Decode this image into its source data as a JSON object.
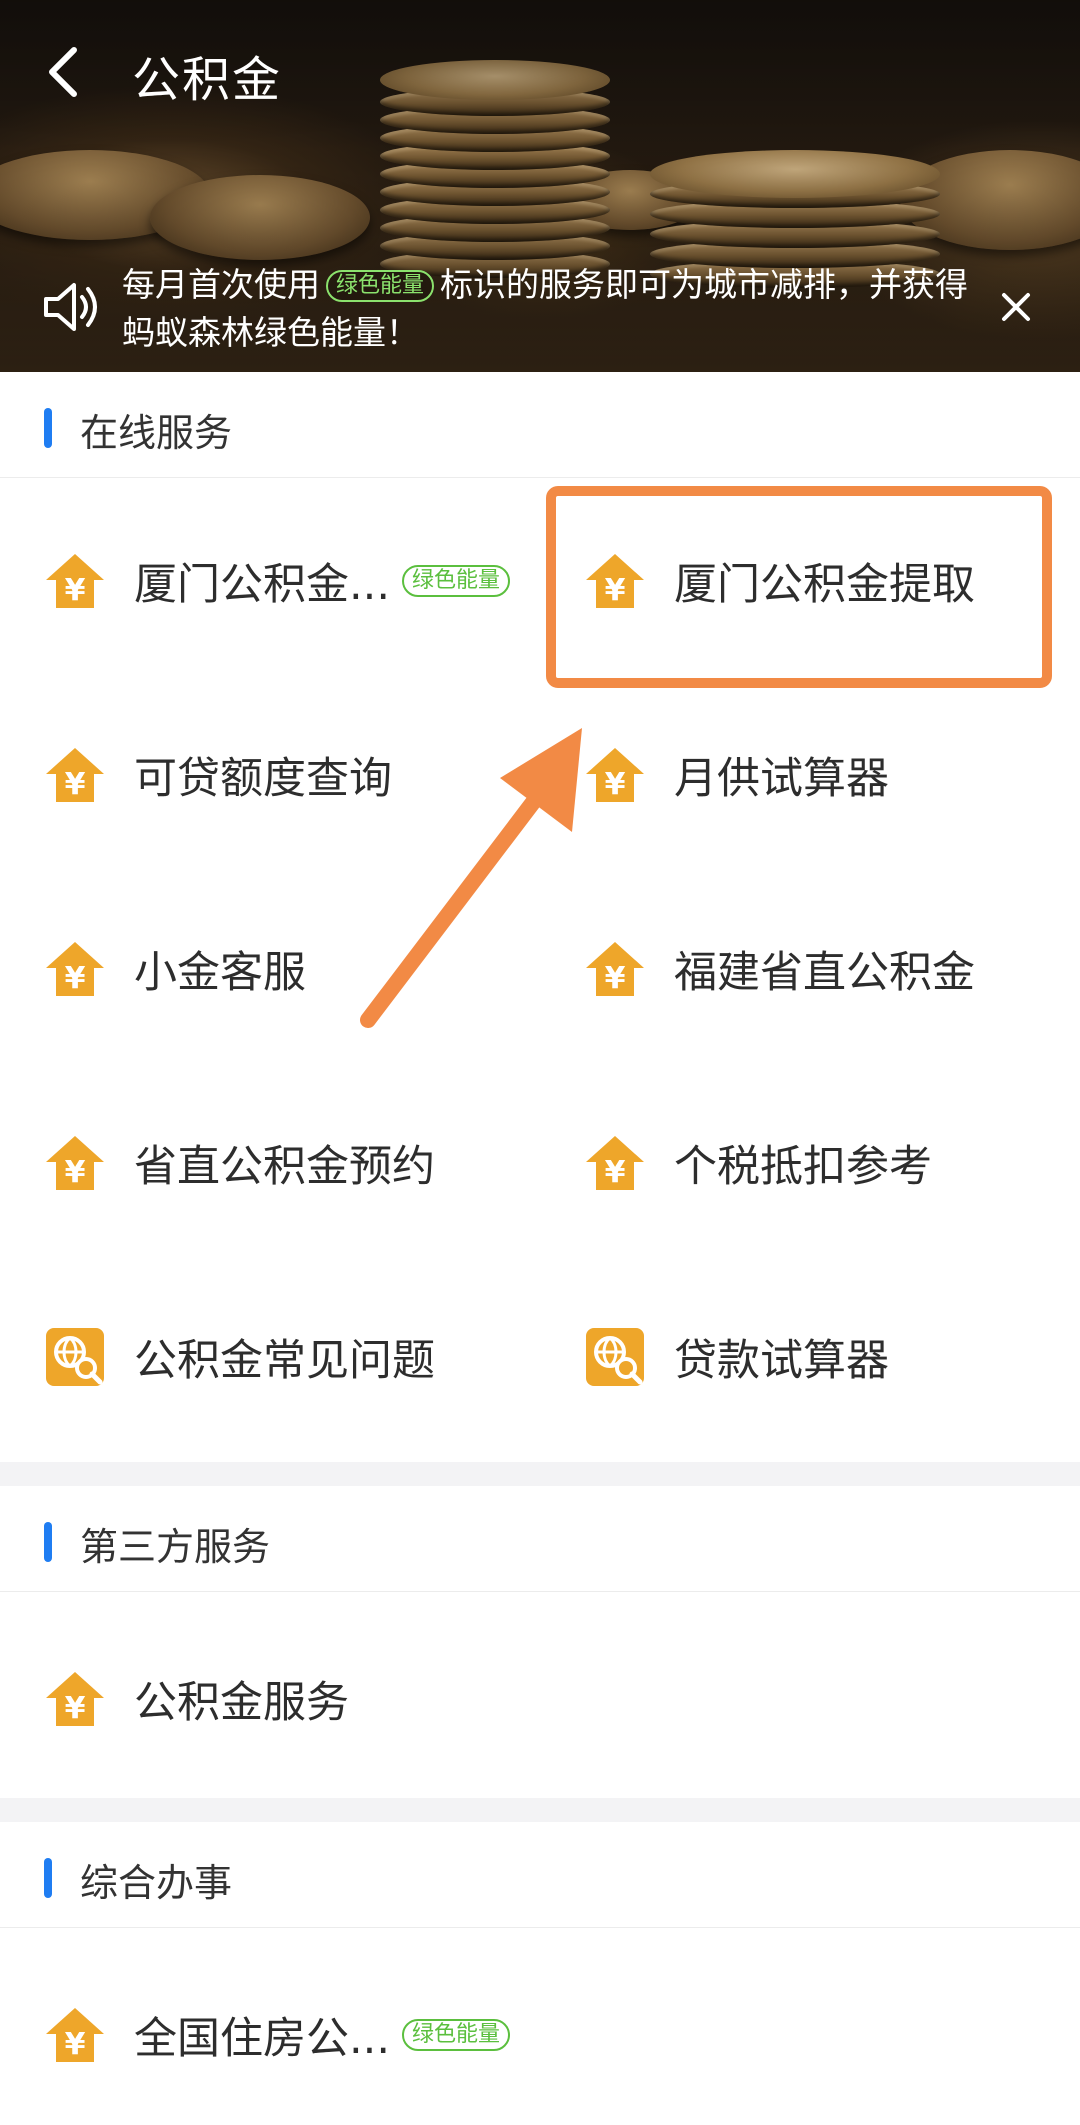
{
  "header": {
    "title": "公积金",
    "notice": {
      "text_before": "每月首次使用",
      "badge": "绿色能量",
      "text_after": "标识的服务即可为城市减排，并获得蚂蚁森林绿色能量！"
    }
  },
  "sections": [
    {
      "title": "在线服务",
      "items": [
        {
          "label": "厦门公积金...",
          "badge": "绿色能量",
          "icon": "house-yuan-icon"
        },
        {
          "label": "厦门公积金提取",
          "icon": "house-yuan-icon"
        },
        {
          "label": "可贷额度查询",
          "icon": "house-yuan-icon"
        },
        {
          "label": "月供试算器",
          "icon": "house-yuan-icon"
        },
        {
          "label": "小金客服",
          "icon": "house-yuan-icon"
        },
        {
          "label": "福建省直公积金",
          "icon": "house-yuan-icon"
        },
        {
          "label": "省直公积金预约",
          "icon": "house-yuan-icon"
        },
        {
          "label": "个税抵扣参考",
          "icon": "house-yuan-icon"
        },
        {
          "label": "公积金常见问题",
          "icon": "globe-search-icon"
        },
        {
          "label": "贷款试算器",
          "icon": "globe-search-icon"
        }
      ]
    },
    {
      "title": "第三方服务",
      "items": [
        {
          "label": "公积金服务",
          "icon": "house-yuan-icon"
        }
      ]
    },
    {
      "title": "综合办事",
      "items": [
        {
          "label": "全国住房公...",
          "badge": "绿色能量",
          "icon": "house-yuan-icon"
        }
      ]
    }
  ],
  "colors": {
    "accent_bar": "#1f7df2",
    "icon_orange": "#eea62a",
    "green_badge": "#5bbf3e",
    "highlight": "#f28a45",
    "section_gap": "#f3f3f5"
  }
}
